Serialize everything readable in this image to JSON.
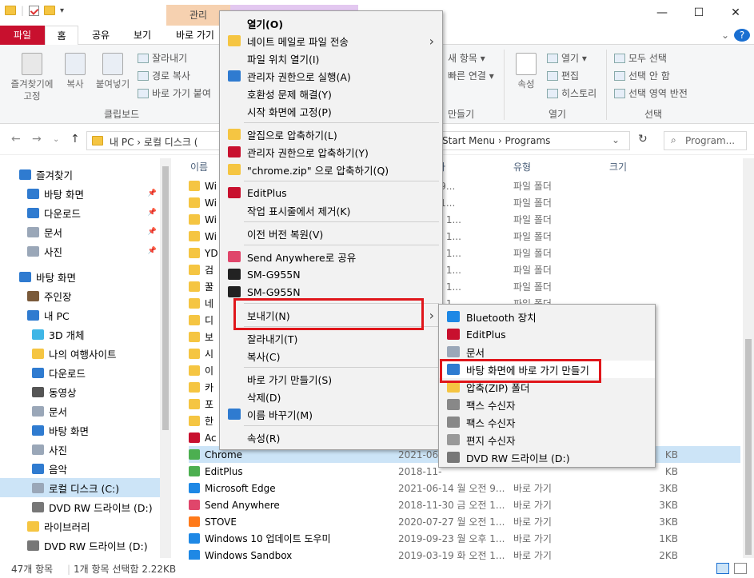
{
  "window": {
    "contextual_tabs": [
      "관리",
      ""
    ],
    "controls": [
      "—",
      "☐",
      "✕"
    ]
  },
  "ribbon": {
    "tabs": [
      "파일",
      "홈",
      "공유",
      "보기",
      "바로 가기"
    ],
    "pin_label": "즐겨찾기에\n고정",
    "copy_label": "복사",
    "paste_label": "붙여넣기",
    "cut_label": "잘라내기",
    "copy_path_label": "경로 복사",
    "paste_shortcut_label": "바로 가기 붙여",
    "group_clipboard": "클립보드",
    "new_item_label": "새 항목 ▾",
    "easy_access_label": "빠른 연결 ▾",
    "new_group": "만들기",
    "properties_label": "속성",
    "open_label": "열기 ▾",
    "edit_label": "편집",
    "history_label": "히스토리",
    "group_open": "열기",
    "select_all": "모두 선택",
    "select_none": "선택 안 함",
    "invert_selection": "선택 영역 반전",
    "group_select": "선택",
    "help": "?"
  },
  "address": {
    "left": "내 PC  ›  로컬 디스크 (",
    "right": "Start Menu  ›  Programs",
    "search_placeholder": "Program..."
  },
  "nav": [
    {
      "label": "즐겨찾기",
      "color": "#2f7bd0",
      "pin": false
    },
    {
      "label": "바탕 화면",
      "color": "#2f7bd0",
      "pin": true
    },
    {
      "label": "다운로드",
      "color": "#2f7bd0",
      "pin": true
    },
    {
      "label": "문서",
      "color": "#9aa7b8",
      "pin": true
    },
    {
      "label": "사진",
      "color": "#9aa7b8",
      "pin": true
    },
    {
      "label": "바탕 화면",
      "color": "#2f7bd0",
      "pin": false
    },
    {
      "label": "주인장",
      "color": "#7a5a3a",
      "pin": false
    },
    {
      "label": "내 PC",
      "color": "#2f7bd0",
      "pin": false
    },
    {
      "label": "3D 개체",
      "color": "#3fb6e6",
      "pin": false
    },
    {
      "label": "나의 여행사이트",
      "color": "#f5c542",
      "pin": false
    },
    {
      "label": "다운로드",
      "color": "#2f7bd0",
      "pin": false
    },
    {
      "label": "동영상",
      "color": "#555",
      "pin": false
    },
    {
      "label": "문서",
      "color": "#9aa7b8",
      "pin": false
    },
    {
      "label": "바탕 화면",
      "color": "#2f7bd0",
      "pin": false
    },
    {
      "label": "사진",
      "color": "#9aa7b8",
      "pin": false
    },
    {
      "label": "음악",
      "color": "#2f7bd0",
      "pin": false
    },
    {
      "label": "로컬 디스크 (C:)",
      "color": "#9aa7b8",
      "pin": false
    },
    {
      "label": "DVD RW 드라이브 (D:)",
      "color": "#777",
      "pin": false
    },
    {
      "label": "라이브러리",
      "color": "#f5c542",
      "pin": false
    },
    {
      "label": "DVD RW 드라이브 (D:)",
      "color": "#777",
      "pin": false
    }
  ],
  "columns": {
    "name": "이름",
    "date": "자",
    "type": "유형",
    "size": "크기"
  },
  "files": [
    {
      "name": "Wi",
      "date": "5 목 오전 9...",
      "type": "파일 폴더",
      "size": "",
      "color": "#f5c542"
    },
    {
      "name": "Wi",
      "date": "5 목 오전 1...",
      "type": "파일 폴더",
      "size": "",
      "color": "#f5c542"
    },
    {
      "name": "Wi",
      "date": "29 금 오전 1...",
      "type": "파일 폴더",
      "size": "",
      "color": "#f5c542"
    },
    {
      "name": "Wi",
      "date": "29 금 오전 1...",
      "type": "파일 폴더",
      "size": "",
      "color": "#f5c542"
    },
    {
      "name": "YD",
      "date": "06 금 오후 1...",
      "type": "파일 폴더",
      "size": "",
      "color": "#f5c542"
    },
    {
      "name": "검",
      "date": "15 목 오후 1...",
      "type": "파일 폴더",
      "size": "",
      "color": "#f5c542"
    },
    {
      "name": "꿀",
      "date": "23 월 오전 1...",
      "type": "파일 폴더",
      "size": "",
      "color": "#f5c542"
    },
    {
      "name": "네",
      "date": "23 월 오후 1...",
      "type": "파일 폴더",
      "size": "",
      "color": "#f5c542"
    },
    {
      "name": "디",
      "date": "",
      "type": "",
      "size": "",
      "color": "#f5c542"
    },
    {
      "name": "보",
      "date": "",
      "type": "",
      "size": "",
      "color": "#f5c542"
    },
    {
      "name": "시",
      "date": "",
      "type": "",
      "size": "",
      "color": "#f5c542"
    },
    {
      "name": "이",
      "date": "",
      "type": "",
      "size": "",
      "color": "#f5c542"
    },
    {
      "name": "카",
      "date": "",
      "type": "",
      "size": "",
      "color": "#f5c542"
    },
    {
      "name": "포",
      "date": "",
      "type": "",
      "size": "",
      "color": "#f5c542"
    },
    {
      "name": "한",
      "date": "",
      "type": "",
      "size": "",
      "color": "#f5c542"
    },
    {
      "name": "Ac",
      "date": "",
      "type": "",
      "size": "",
      "color": "#c8102e"
    },
    {
      "name": "Chrome",
      "date": "2021-06-1",
      "type": "",
      "size": "KB",
      "color": "#4caf50"
    },
    {
      "name": "EditPlus",
      "date": "2018-11-",
      "type": "",
      "size": "KB",
      "color": "#4caf50"
    },
    {
      "name": "Microsoft Edge",
      "date": "2021-06-14 월 오전 9...",
      "type": "바로 가기",
      "size": "3KB",
      "color": "#1e88e5"
    },
    {
      "name": "Send Anywhere",
      "date": "2018-11-30 금 오전 1...",
      "type": "바로 가기",
      "size": "3KB",
      "color": "#e0466b"
    },
    {
      "name": "STOVE",
      "date": "2020-07-27 월 오전 1...",
      "type": "바로 가기",
      "size": "3KB",
      "color": "#ff7a1a"
    },
    {
      "name": "Windows 10 업데이트 도우미",
      "date": "2019-09-23 월 오후 1...",
      "type": "바로 가기",
      "size": "1KB",
      "color": "#1e88e5"
    },
    {
      "name": "Windows Sandbox",
      "date": "2019-03-19 화 오전 1...",
      "type": "바로 가기",
      "size": "2KB",
      "color": "#1e88e5"
    }
  ],
  "status": {
    "count": "47개 항목",
    "selected": "1개 항목 선택함 2.22KB"
  },
  "context_menu": [
    {
      "label": "열기(O)",
      "bold": true,
      "icon": ""
    },
    {
      "label": "네이트 메일로 파일 전송",
      "icon": "#f5c542",
      "arrow": true
    },
    {
      "label": "파일 위치 열기(I)",
      "icon": ""
    },
    {
      "label": "관리자 권한으로 실행(A)",
      "icon": "#2f7bd0"
    },
    {
      "label": "호환성 문제 해결(Y)",
      "icon": ""
    },
    {
      "label": "시작 화면에 고정(P)",
      "icon": ""
    },
    {
      "sep": true
    },
    {
      "label": "알집으로 압축하기(L)",
      "icon": "#f5c542"
    },
    {
      "label": "관리자 권한으로 압축하기(Y)",
      "icon": "#c8102e"
    },
    {
      "label": "\"chrome.zip\" 으로 압축하기(Q)",
      "icon": "#f5c542"
    },
    {
      "sep": true
    },
    {
      "label": "EditPlus",
      "icon": "#c8102e"
    },
    {
      "label": "작업 표시줄에서 제거(K)",
      "icon": ""
    },
    {
      "sep": true
    },
    {
      "label": "이전 버전 복원(V)",
      "icon": ""
    },
    {
      "sep": true
    },
    {
      "label": "Send Anywhere로 공유",
      "icon": "#e0466b"
    },
    {
      "label": "SM-G955N",
      "icon": "#222"
    },
    {
      "label": "SM-G955N",
      "icon": "#222"
    },
    {
      "sep": true
    },
    {
      "label": "보내기(N)",
      "icon": "",
      "arrow": true,
      "highlight": true
    },
    {
      "sep": true
    },
    {
      "label": "잘라내기(T)",
      "icon": ""
    },
    {
      "label": "복사(C)",
      "icon": ""
    },
    {
      "sep": true
    },
    {
      "label": "바로 가기 만들기(S)",
      "icon": ""
    },
    {
      "label": "삭제(D)",
      "icon": ""
    },
    {
      "label": "이름 바꾸기(M)",
      "icon": "#2f7bd0"
    },
    {
      "sep": true
    },
    {
      "label": "속성(R)",
      "icon": ""
    }
  ],
  "send_to_menu": [
    {
      "label": "Bluetooth 장치",
      "icon": "#1e88e5"
    },
    {
      "label": "EditPlus",
      "icon": "#c8102e"
    },
    {
      "label": "문서",
      "icon": "#9aa7b8"
    },
    {
      "label": "바탕 화면에 바로 가기 만들기",
      "icon": "#2f7bd0",
      "highlight": true
    },
    {
      "label": "압축(ZIP) 폴더",
      "icon": "#f5c542"
    },
    {
      "label": "팩스 수신자",
      "icon": "#888"
    },
    {
      "label": "팩스 수신자",
      "icon": "#888"
    },
    {
      "label": "편지 수신자",
      "icon": "#999"
    },
    {
      "label": "DVD RW 드라이브 (D:)",
      "icon": "#777"
    }
  ]
}
